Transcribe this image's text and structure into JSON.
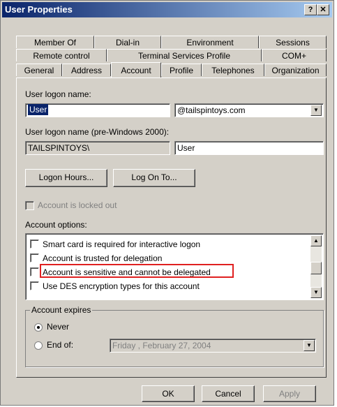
{
  "window": {
    "title": "User Properties",
    "help_label": "?",
    "close_label": "✕"
  },
  "tabs": {
    "row1": [
      "Member Of",
      "Dial-in",
      "Environment",
      "Sessions"
    ],
    "row2": [
      "Remote control",
      "Terminal Services Profile",
      "COM+"
    ],
    "row3": [
      "General",
      "Address",
      "Account",
      "Profile",
      "Telephones",
      "Organization"
    ],
    "selected": "Account"
  },
  "account": {
    "logon_name_label": "User logon name:",
    "logon_name_value": "User",
    "domain_value": "@tailspintoys.com",
    "pre2000_label": "User logon name (pre-Windows 2000):",
    "pre2000_domain": "TAILSPINTOYS\\",
    "pre2000_user": "User",
    "logon_hours_button": "Logon Hours...",
    "log_on_to_button": "Log On To...",
    "locked_out_label": "Account is locked out",
    "options_label": "Account options:",
    "options": [
      "Smart card is required for interactive logon",
      "Account is trusted for delegation",
      "Account is sensitive and cannot be delegated",
      "Use DES encryption types for this account"
    ],
    "expires_label": "Account expires",
    "never_label": "Never",
    "end_of_label": "End of:",
    "end_of_date": "Friday    ,  February  27, 2004"
  },
  "footer": {
    "ok": "OK",
    "cancel": "Cancel",
    "apply": "Apply"
  }
}
